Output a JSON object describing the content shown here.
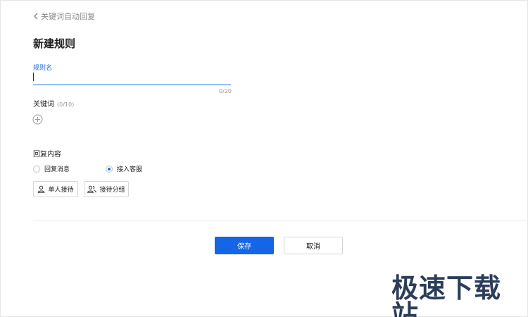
{
  "header": {
    "back_label": "关键词自动回复",
    "page_title": "新建规则"
  },
  "rule_name": {
    "label": "规则名",
    "value": "",
    "counter": "0/20"
  },
  "keywords": {
    "label": "关键词",
    "count": "(0/10)",
    "add_icon": "plus-circle-icon"
  },
  "reply": {
    "label": "回复内容",
    "options": [
      {
        "label": "回复消息",
        "checked": false
      },
      {
        "label": "接入客服",
        "checked": true
      }
    ],
    "assign_buttons": [
      {
        "label": "单人接待",
        "icon": "user-icon"
      },
      {
        "label": "接待分组",
        "icon": "users-icon"
      }
    ]
  },
  "footer": {
    "save_label": "保存",
    "cancel_label": "取消"
  },
  "watermark": "极速下载站",
  "colors": {
    "accent": "#1565e6",
    "label_blue": "#1a6fe0",
    "muted": "#9a9a9a"
  }
}
